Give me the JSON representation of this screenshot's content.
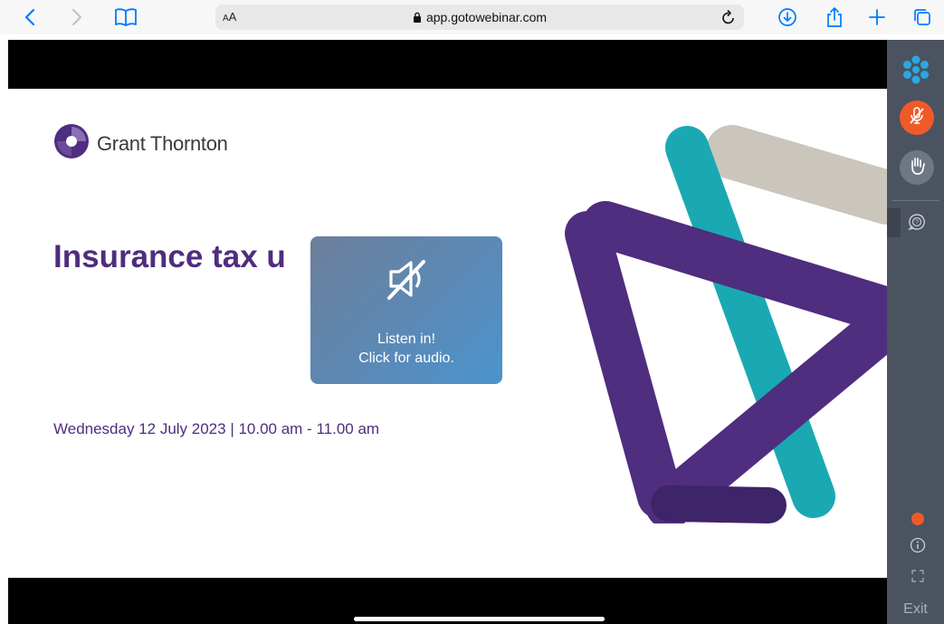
{
  "browser": {
    "text_size_label_small": "A",
    "text_size_label_large": "A",
    "url": "app.gotowebinar.com"
  },
  "slide": {
    "logo_text": "Grant Thornton",
    "title": "Insurance tax u",
    "date_line": "Wednesday 12 July 2023  |  10.00 am - 11.00 am"
  },
  "audio_prompt": {
    "line1": "Listen in!",
    "line2": "Click for audio."
  },
  "sidebar": {
    "exit_label": "Exit"
  },
  "colors": {
    "brand_purple": "#4f2d7f",
    "teal": "#1aa9b3",
    "beige": "#cbc6bb",
    "mic_orange": "#f05a28",
    "status_dot": "#f05a28",
    "sidebar_bg": "#4b5360",
    "browser_blue": "#007aff"
  },
  "icons": [
    "back-icon",
    "forward-icon",
    "bookmarks-icon",
    "lock-icon",
    "reload-icon",
    "download-icon",
    "share-icon",
    "new-tab-icon",
    "tabs-icon",
    "grant-thornton-logo-icon",
    "audio-muted-icon",
    "gotowebinar-logo-icon",
    "mic-muted-icon",
    "raise-hand-icon",
    "question-icon",
    "info-icon",
    "fullscreen-icon"
  ]
}
